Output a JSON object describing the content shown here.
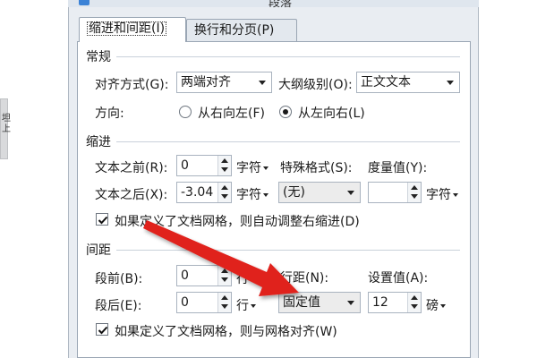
{
  "dialog": {
    "title": "段落",
    "background_sidebar_text": "坦\n上"
  },
  "tabs": [
    {
      "label": "缩进和间距(I)",
      "active": true
    },
    {
      "label": "换行和分页(P)",
      "active": false
    }
  ],
  "general": {
    "title": "常规",
    "alignment_label": "对齐方式(G):",
    "alignment_value": "两端对齐",
    "outline_label": "大纲级别(O):",
    "outline_value": "正文文本",
    "direction_label": "方向:",
    "rtl_label": "从右向左(F)",
    "ltr_label": "从左向右(L)",
    "direction_selected": "ltr"
  },
  "indent": {
    "title": "缩进",
    "before_label": "文本之前(R):",
    "before_value": "0",
    "before_unit": "字符",
    "after_label": "文本之后(X):",
    "after_value": "-3.04",
    "after_unit": "字符",
    "special_label": "特殊格式(S):",
    "special_value": "(无)",
    "measure_label": "度量值(Y):",
    "measure_value": "",
    "measure_unit": "字符",
    "auto_adjust_label": "如果定义了文档网格，则自动调整右缩进(D)",
    "auto_adjust_checked": true
  },
  "spacing": {
    "title": "间距",
    "before_label": "段前(B):",
    "before_value": "0",
    "before_unit": "行",
    "after_label": "段后(E):",
    "after_value": "0",
    "after_unit": "行",
    "line_spacing_label": "行距(N):",
    "line_spacing_value": "固定值",
    "set_value_label": "设置值(A):",
    "set_value": "12",
    "set_value_unit": "磅",
    "snap_grid_label": "如果定义了文档网格，则与网格对齐(W)",
    "snap_grid_checked": true
  },
  "colors": {
    "dialog_bg": "#e9edf2",
    "arrow": "#e0201b"
  }
}
